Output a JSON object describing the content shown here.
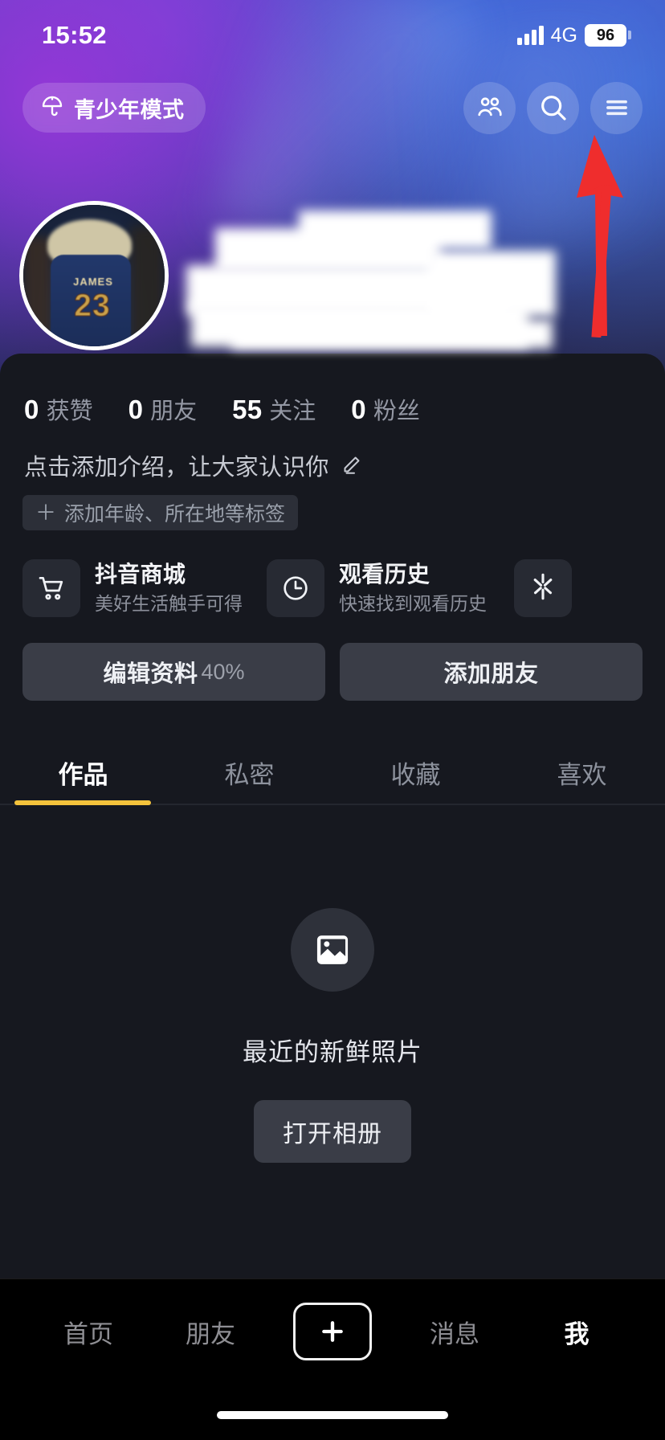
{
  "status_bar": {
    "time": "15:52",
    "network": "4G",
    "battery": "96",
    "signal_icon": "cellular-signal-icon",
    "battery_icon": "battery-icon"
  },
  "header": {
    "teen_mode": {
      "label": "青少年模式",
      "icon": "umbrella-icon"
    },
    "icons": [
      {
        "name": "friends-icon",
        "label": "朋友"
      },
      {
        "name": "search-icon",
        "label": "搜索"
      },
      {
        "name": "hamburger-menu-icon",
        "label": "菜单"
      }
    ],
    "annotation_arrow": {
      "name": "red-pointer-arrow",
      "color": "#ef2d2d",
      "points_to": "hamburger-menu-icon"
    }
  },
  "profile": {
    "avatar": {
      "name": "user-avatar",
      "jersey_name": "JAMES",
      "jersey_number": "23"
    },
    "nickname_redacted": "",
    "stats": [
      {
        "value": "0",
        "label": "获赞"
      },
      {
        "value": "0",
        "label": "朋友"
      },
      {
        "value": "55",
        "label": "关注"
      },
      {
        "value": "0",
        "label": "粉丝"
      }
    ],
    "bio_placeholder": "点击添加介绍，让大家认识你",
    "bio_edit_icon": "pencil-icon",
    "add_tag": {
      "plus": "＋",
      "label": "添加年龄、所在地等标签"
    }
  },
  "shortcut_cards": [
    {
      "icon": "shopping-cart-icon",
      "title": "抖音商城",
      "subtitle": "美好生活触手可得"
    },
    {
      "icon": "clock-icon",
      "title": "观看历史",
      "subtitle": "快速找到观看历史"
    },
    {
      "icon": "douyin-spark-icon",
      "title": "",
      "subtitle": ""
    }
  ],
  "action_buttons": {
    "edit_profile": {
      "label": "编辑资料",
      "progress": "40%"
    },
    "add_friend": {
      "label": "添加朋友"
    }
  },
  "content_tabs": {
    "active_index": 0,
    "indicator_color": "#f4c33c",
    "items": [
      {
        "label": "作品"
      },
      {
        "label": "私密"
      },
      {
        "label": "收藏"
      },
      {
        "label": "喜欢"
      }
    ]
  },
  "empty_state": {
    "icon": "photo-placeholder-icon",
    "title": "最近的新鲜照片",
    "button_label": "打开相册"
  },
  "bottom_nav": {
    "active_index": 4,
    "items": [
      {
        "label": "首页"
      },
      {
        "label": "朋友"
      },
      {
        "label": "",
        "icon": "plus-create-icon"
      },
      {
        "label": "消息"
      },
      {
        "label": "我"
      }
    ]
  },
  "colors": {
    "accent_yellow": "#f4c33c",
    "annotation_red": "#ef2d2d",
    "panel_bg": "#16181f",
    "card_bg": "#272a33",
    "button_bg": "#3a3d47"
  }
}
